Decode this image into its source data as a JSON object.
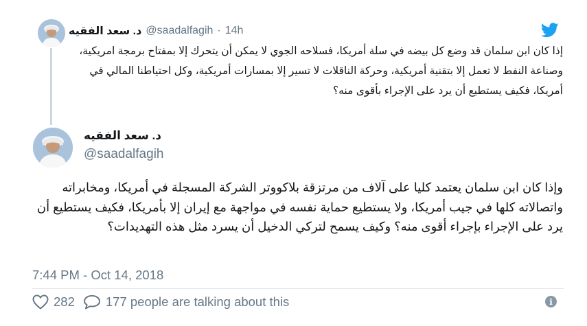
{
  "brand": {
    "icon": "twitter-bird-icon",
    "color": "#1da1f2"
  },
  "reply_tweet": {
    "author_name": "د. سعد الفقيه",
    "handle": "@saadalfagih",
    "separator": "·",
    "time": "14h",
    "text": "إذا كان ابن سلمان قد وضع كل بيضه في سلة أمريكا، فسلاحه الجوي لا يمكن أن يتحرك إلا بمفتاح برمجة امريكية، وصناعة النفط لا تعمل إلا بتقنية أمريكية، وحركة الناقلات لا تسير إلا بمسارات أمريكية، وكل احتياطنا المالي في أمريكا، فكيف يستطيع أن يرد على الإجراء بأقوى منه؟"
  },
  "main_tweet": {
    "author_name": "د. سعد الفقيه",
    "handle": "@saadalfagih",
    "text": "وإذا كان ابن سلمان يعتمد كليا على آلاف من مرتزقة بلاكووتر الشركة المسجلة في أمريكا، ومخابراته واتصالاته كلها في جيب أمريكا، ولا يستطيع حماية نفسه في مواجهة مع إيران إلا بأمريكا، فكيف يستطيع أن يرد على الإجراء بإجراء أقوى منه؟ وكيف يسمح لتركي الدخيل أن يسرد مثل هذه التهديدات؟",
    "timestamp": "7:44 PM - Oct 14, 2018"
  },
  "actions": {
    "like_icon": "heart-icon",
    "like_count": "282",
    "reply_icon": "speech-bubble-icon",
    "reply_text": "177 people are talking about this",
    "info_icon": "info-icon",
    "info_glyph": "i"
  }
}
